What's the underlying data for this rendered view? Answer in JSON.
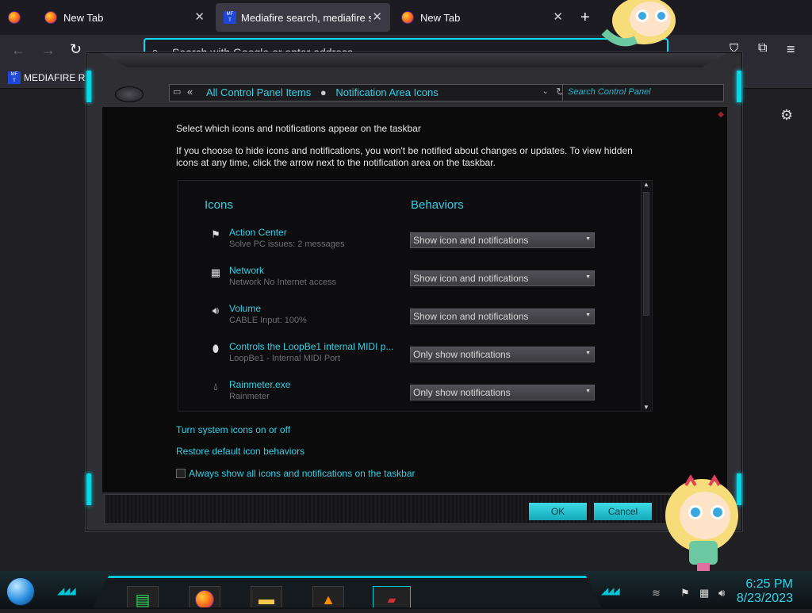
{
  "browser": {
    "tabs": [
      {
        "title": "New Tab"
      },
      {
        "title": "Mediafire search, mediafire sea"
      },
      {
        "title": "New Tab"
      }
    ],
    "address_placeholder": "Search with Google or enter address",
    "bookmark": "MEDIAFIRE RO"
  },
  "control_panel": {
    "breadcrumb": [
      "All Control Panel Items",
      "Notification Area Icons"
    ],
    "search_placeholder": "Search Control Panel",
    "heading": "Select which icons and notifications appear on the taskbar",
    "description": "If you choose to hide icons and notifications, you won't be notified about changes or updates. To view hidden icons at any time, click the arrow next to the notification area on the taskbar.",
    "columns": {
      "icons": "Icons",
      "behaviors": "Behaviors"
    },
    "rows": [
      {
        "name": "Action Center",
        "sub": "Solve PC issues: 2 messages",
        "behavior": "Show icon and notifications",
        "icon": "flag-icon"
      },
      {
        "name": "Network",
        "sub": "Network No Internet access",
        "behavior": "Show icon and notifications",
        "icon": "network-icon"
      },
      {
        "name": "Volume",
        "sub": "CABLE Input: 100%",
        "behavior": "Show icon and notifications",
        "icon": "speaker-icon"
      },
      {
        "name": "Controls the LoopBe1 internal MIDI p...",
        "sub": "LoopBe1 - Internal MIDI Port",
        "behavior": "Only show notifications",
        "icon": "midi-icon"
      },
      {
        "name": "Rainmeter.exe",
        "sub": "Rainmeter",
        "behavior": "Only show notifications",
        "icon": "raindrop-icon"
      }
    ],
    "links": [
      "Turn system icons on or off",
      "Restore default icon behaviors"
    ],
    "checkbox_label": "Always show all icons and notifications on the taskbar",
    "ok": "OK",
    "cancel": "Cancel"
  },
  "taskbar": {
    "time": "6:25 PM",
    "date": "8/23/2023"
  }
}
